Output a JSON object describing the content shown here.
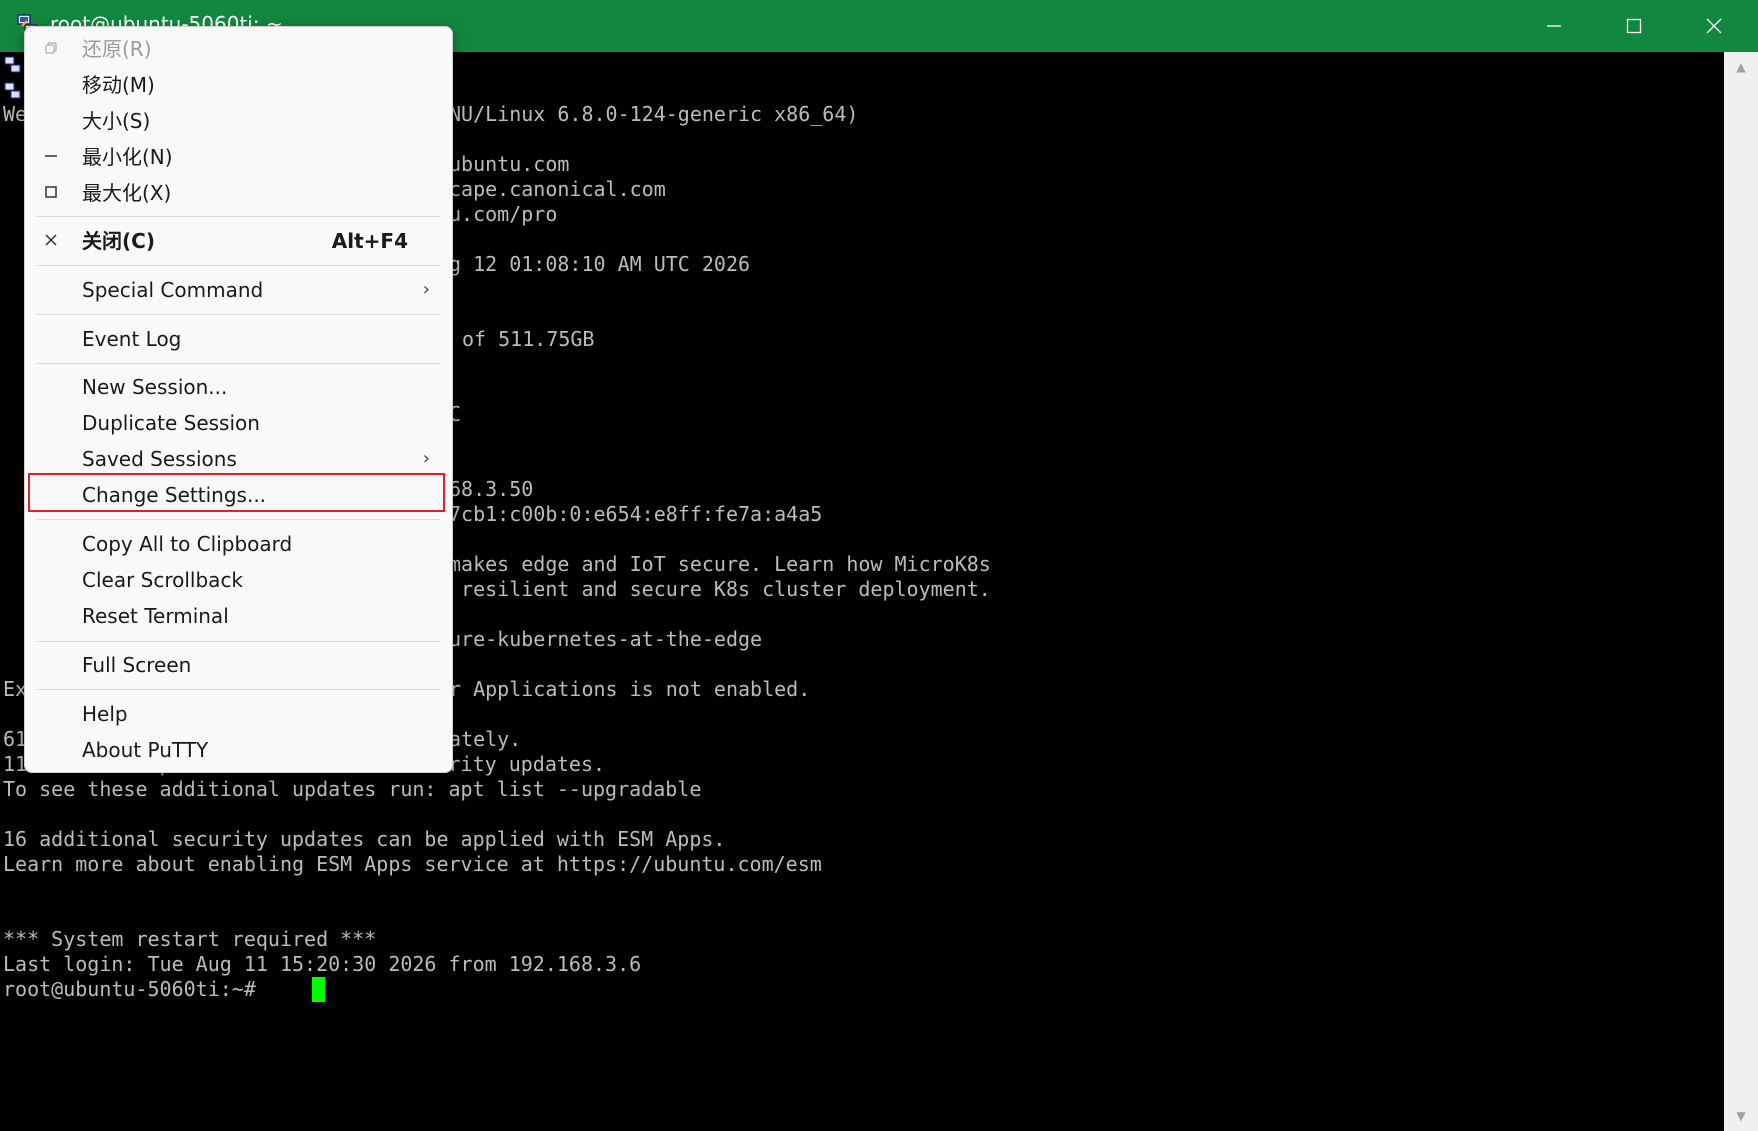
{
  "window": {
    "title": "root@ubuntu-5060ti: ~",
    "controls": {
      "minimize_icon": "minimize-icon",
      "maximize_icon": "maximize-icon",
      "close_icon": "close-icon"
    }
  },
  "terminal": {
    "lines": [
      "We",
      "NU/Linux 6.8.0-124-generic x86_64)",
      "ubuntu.com",
      "cape.canonical.com",
      "u.com/pro",
      "g 12 01:08:10 AM UTC 2026",
      "of 511.75GB",
      "C",
      "68.3.50",
      "7cb1:c00b:0:e654:e8ff:fe7a:a4a5",
      "makes edge and IoT secure. Learn how MicroK8s",
      " resilient and secure K8s cluster deployment.",
      "ure-kubernetes-at-the-edge",
      "Ex",
      "r Applications is not enabled.",
      "61",
      "ately.",
      "11 of these updates are standard security updates.",
      "To see these additional updates run: apt list --upgradable",
      "16 additional security updates can be applied with ESM Apps.",
      "Learn more about enabling ESM Apps service at https://ubuntu.com/esm",
      "*** System restart required ***",
      "Last login: Tue Aug 11 15:20:30 2026 from 192.168.3.6",
      "root@ubuntu-5060ti:~# "
    ],
    "cursor_color": "#00ff00"
  },
  "menu": {
    "items": [
      {
        "label": "还原(R)",
        "icon": "restore-icon"
      },
      {
        "label": "移动(M)"
      },
      {
        "label": "大小(S)"
      },
      {
        "label": "最小化(N)",
        "icon": "minimize-icon"
      },
      {
        "label": "最大化(X)",
        "icon": "maximize-icon"
      },
      {
        "label": "关闭(C)",
        "accel": "Alt+F4",
        "icon": "close-icon"
      },
      {
        "label": "Special Command",
        "submenu": "chevron-right-icon"
      },
      {
        "label": "Event Log"
      },
      {
        "label": "New Session..."
      },
      {
        "label": "Duplicate Session"
      },
      {
        "label": "Saved Sessions",
        "submenu": "chevron-right-icon"
      },
      {
        "label": "Change Settings..."
      },
      {
        "label": "Copy All to Clipboard"
      },
      {
        "label": "Clear Scrollback"
      },
      {
        "label": "Reset Terminal"
      },
      {
        "label": "Full Screen"
      },
      {
        "label": "Help"
      },
      {
        "label": "About PuTTY"
      }
    ],
    "highlight_color": "#e0202a"
  },
  "colors": {
    "titlebar": "#12883f",
    "terminal_bg": "#000000",
    "terminal_fg": "#bbbbbb"
  }
}
